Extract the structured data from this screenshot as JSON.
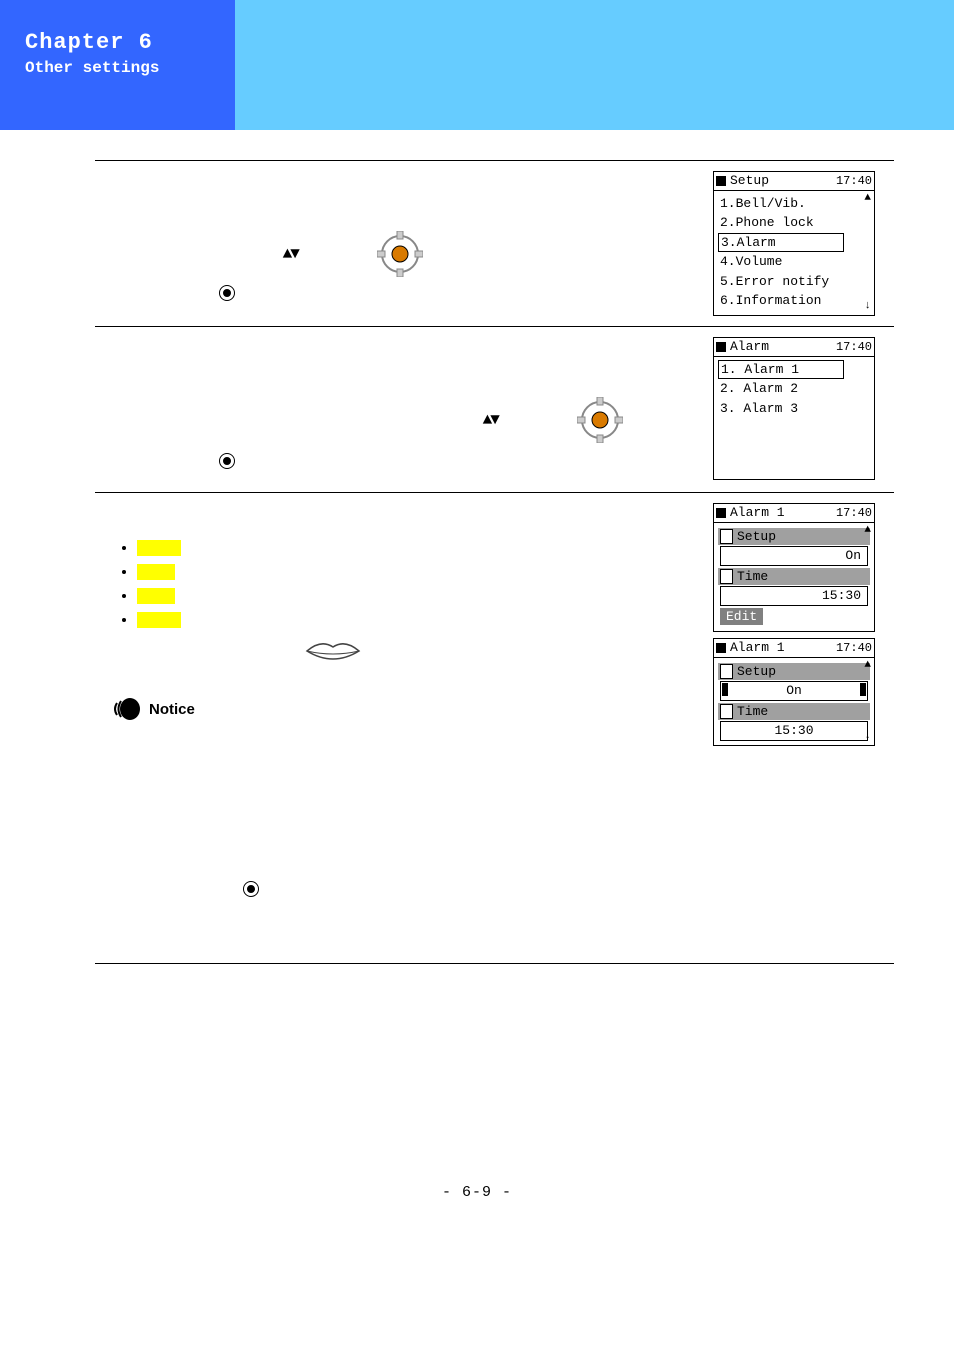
{
  "header": {
    "chapter": "Chapter 6",
    "subtitle": "Other settings"
  },
  "screens": {
    "setup": {
      "title": "Setup",
      "time": "17:40",
      "items": [
        "1.Bell/Vib.",
        "2.Phone lock",
        "3.Alarm",
        "4.Volume",
        "5.Error notify",
        "6.Information"
      ],
      "selected": "3.Alarm"
    },
    "alarm_list": {
      "title": "Alarm",
      "time": "17:40",
      "items": [
        "1. Alarm 1",
        "2. Alarm 2",
        "3. Alarm 3"
      ],
      "selected": "1. Alarm 1"
    },
    "alarm1_view": {
      "title": "Alarm 1",
      "time": "17:40",
      "setup_label": "Setup",
      "setup_value": "On",
      "time_label": "Time",
      "time_value": "15:30",
      "edit_label": "Edit"
    },
    "alarm1_edit": {
      "title": "Alarm 1",
      "time": "17:40",
      "setup_label": "Setup",
      "setup_value": "On",
      "time_label": "Time",
      "time_value": "15:30"
    }
  },
  "notice_label": "Notice",
  "page_number": "- 6-9 -"
}
